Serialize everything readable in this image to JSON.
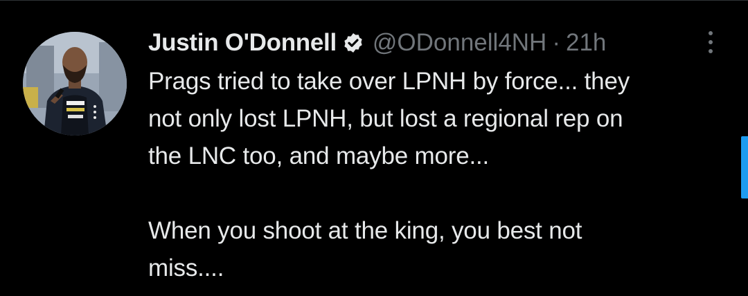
{
  "tweet": {
    "author": {
      "display_name": "Justin O'Donnell",
      "handle": "@ODonnell4NH",
      "verified_icon": "verified-badge-icon",
      "avatar": "profile-photo"
    },
    "separator": "·",
    "timestamp": "21h",
    "more_icon": "more-vertical-icon",
    "text_lines": [
      "Prags tried to take over LPNH by force... they",
      "not only lost LPNH, but lost a regional rep on",
      "the LNC too, and maybe more...",
      "",
      "When you shoot at the king, you best not",
      "miss...."
    ]
  },
  "colors": {
    "background": "#000000",
    "primary_text": "#e7e9ea",
    "secondary_text": "#71767b",
    "accent": "#1d9bf0"
  }
}
